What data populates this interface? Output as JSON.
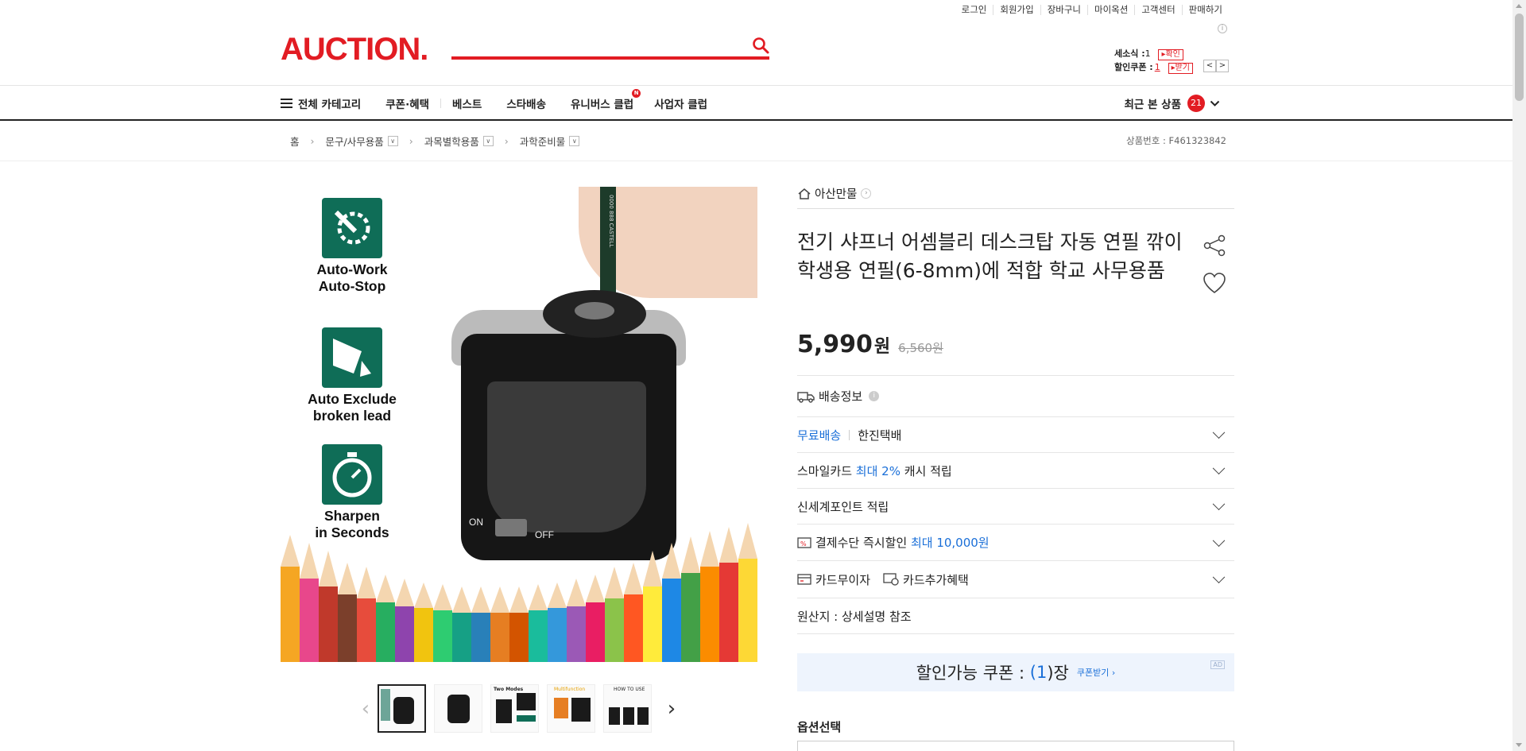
{
  "util_links": [
    "로그인",
    "회원가입",
    "장바구니",
    "마이옥션",
    "고객센터",
    "판매하기"
  ],
  "util_info": "i",
  "header": {
    "logo": "AUCTION.",
    "mini_1_label": "세소식 :",
    "mini_1_value": "1",
    "mini_1_btn": "확인",
    "mini_2_label": "할인쿠폰 :",
    "mini_2_value": "1",
    "mini_2_btn": "받기",
    "pager_prev": "<",
    "pager_next": ">"
  },
  "gnb": {
    "all_categories": "전체 카테고리",
    "items": [
      "쿠폰·혜택",
      "베스트",
      "스타배송",
      "유니버스 클럽",
      "사업자 클럽"
    ],
    "new_badge": "N",
    "recent_label": "최근 본 상품",
    "recent_count": "21"
  },
  "breadcrumb": {
    "home": "홈",
    "levels": [
      "문구/사무용품",
      "과목별학용품",
      "과학준비물"
    ],
    "product_no": "상품번호 : F461323842"
  },
  "image_features": [
    {
      "line1": "Auto-Work",
      "line2": "Auto-Stop"
    },
    {
      "line1": "Auto Exclude",
      "line2": "broken lead"
    },
    {
      "line1": "Sharpen",
      "line2": "in Seconds"
    }
  ],
  "image_labels": {
    "on": "ON",
    "off": "OFF",
    "pencil_text": "0000 888 CASTELL"
  },
  "thumbnail_texts": [
    "Two Modes",
    "Multifunction",
    "HOW TO USE"
  ],
  "product": {
    "shop_name": "아산만물",
    "title": "전기 샤프너 어셈블리 데스크탑 자동 연필 깎이 학생용 연필(6-8mm)에 적합 학교 사무용품",
    "price": "5,990",
    "currency": "원",
    "original_price": "6,560원"
  },
  "info_rows": {
    "shipping_title": "배송정보",
    "free_shipping": "무료배송",
    "courier": "한진택배",
    "smilecard_1": "스마일카드",
    "smilecard_2": "최대 2%",
    "smilecard_3": "캐시 적립",
    "ssg_point": "신세계포인트 적립",
    "pay_discount_1": "결제수단 즉시할인",
    "pay_discount_2": "최대 10,000원",
    "card_interest": "카드무이자",
    "card_benefit": "카드추가혜택",
    "origin": "원산지 : 상세설명 참조"
  },
  "coupon": {
    "label": "할인가능 쿠폰 :",
    "count_open": "(",
    "count": "1",
    "count_close": ")장",
    "link": "쿠폰받기 ›",
    "ad": "AD"
  },
  "option": {
    "label": "옵션선택"
  },
  "colors": {
    "brand": "#e21c23",
    "link": "#1a6fd8",
    "feature": "#0f6d57"
  }
}
